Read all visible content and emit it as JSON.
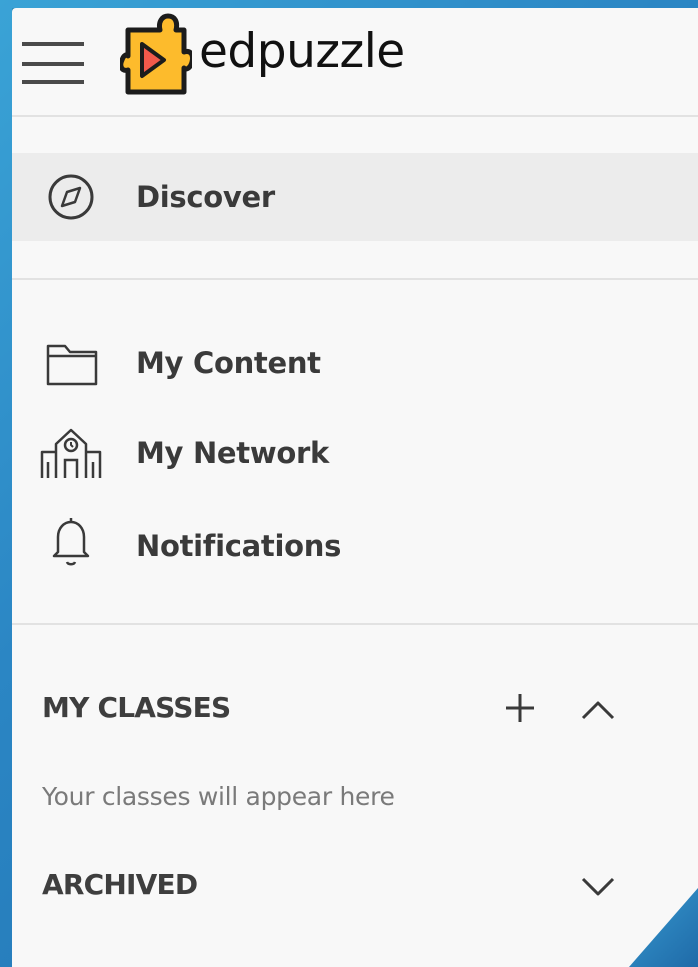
{
  "brand": {
    "name": "edpuzzle",
    "logo_colors": {
      "puzzle_fill": "#fdbb2c",
      "puzzle_outline": "#1c1c1c",
      "arrow": "#f2594b"
    }
  },
  "nav": {
    "primary": [
      {
        "label": "Discover",
        "icon": "compass-icon",
        "active": true
      }
    ],
    "secondary": [
      {
        "label": "My Content",
        "icon": "folder-icon"
      },
      {
        "label": "My Network",
        "icon": "school-icon"
      },
      {
        "label": "Notifications",
        "icon": "bell-icon"
      }
    ]
  },
  "classes": {
    "title": "MY CLASSES",
    "empty_message": "Your classes will appear here",
    "add_icon": "plus-icon",
    "collapse_icon": "chevron-up-icon"
  },
  "archived": {
    "title": "ARCHIVED",
    "expand_icon": "chevron-down-icon"
  },
  "colors": {
    "panel_bg": "#f8f8f8",
    "active_item_bg": "#ececec",
    "divider": "#e2e2e2",
    "text_primary": "#3a3a3a",
    "text_muted": "#7a7a7a"
  }
}
